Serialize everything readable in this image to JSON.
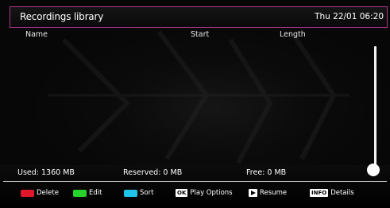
{
  "header": {
    "title": "Recordings library",
    "datetime": "Thu 22/01 06:20"
  },
  "columns": {
    "name": "Name",
    "start": "Start",
    "length": "Length"
  },
  "recordings": [],
  "storage": {
    "used": "Used: 1360 MB",
    "reserved": "Reserved: 0 MB",
    "free": "Free: 0 MB"
  },
  "keys": {
    "delete": {
      "label": "Delete",
      "color": "#e0172a"
    },
    "edit": {
      "label": "Edit",
      "color": "#27d22a"
    },
    "sort": {
      "label": "Sort",
      "color": "#1fc4e8"
    },
    "play_options": {
      "chip": "OK",
      "label": "Play Options"
    },
    "resume": {
      "label": "Resume"
    },
    "details": {
      "chip": "INFO",
      "label": "Details"
    }
  },
  "colors": {
    "accent": "#b0368d",
    "background": "#070707"
  }
}
